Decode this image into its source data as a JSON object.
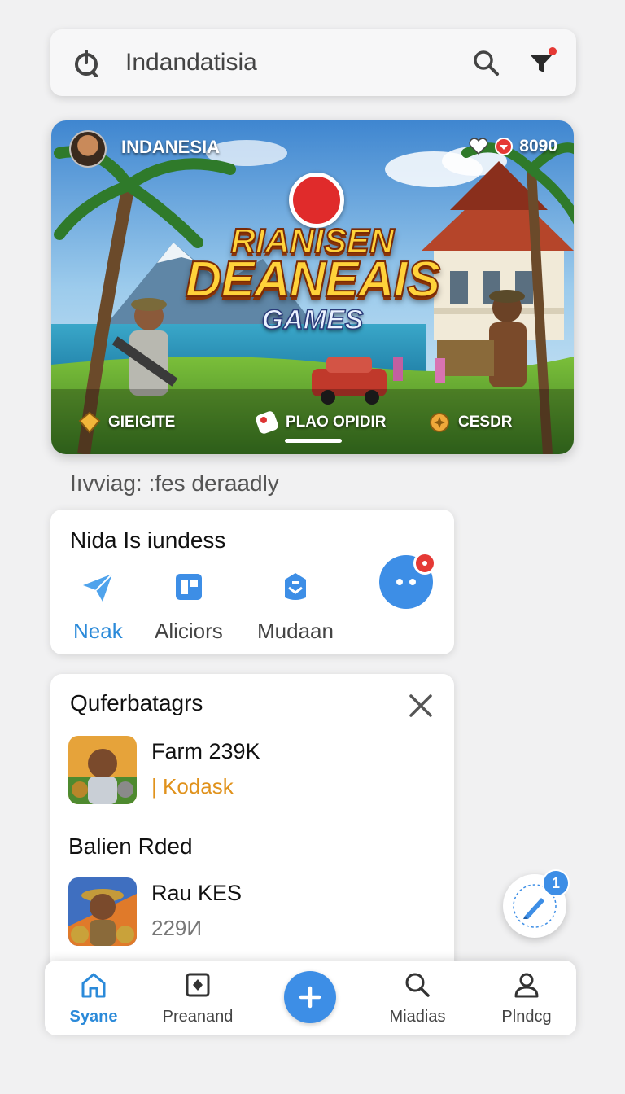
{
  "search": {
    "value": "Indandatisia"
  },
  "banner": {
    "country": "INDANESIA",
    "stats": "8090",
    "logo_line1": "RIANISEN",
    "logo_line2": "DEANEAIS",
    "logo_line3": "GAMES",
    "chips": [
      {
        "label": "GIEIGITE",
        "icon": "diamond-icon"
      },
      {
        "label": "PLAO OPIDIR",
        "icon": "tag-icon"
      },
      {
        "label": "CESDR",
        "icon": "coin-icon"
      }
    ]
  },
  "subtitle": "Iıvviag: :fes deraadly",
  "quick_actions": {
    "title": "Nida Is iundess",
    "items": [
      {
        "label": "Neak",
        "icon": "paper-plane-icon"
      },
      {
        "label": "Aliciors",
        "icon": "document-icon"
      },
      {
        "label": "Mudaan",
        "icon": "bag-icon"
      }
    ]
  },
  "recommendations": {
    "title": "Quferbatagrs",
    "games": [
      {
        "name": "Farm 239K",
        "meta": "| Kodask"
      }
    ],
    "section_title": "Balien Rded",
    "section_games": [
      {
        "name": "Rau KES",
        "meta": "229И"
      }
    ]
  },
  "compose_badge": "1",
  "bottom_nav": [
    {
      "label": "Syane",
      "icon": "home-icon"
    },
    {
      "label": "Preanand",
      "icon": "bookmark-icon"
    },
    {
      "label": "Miadias",
      "icon": "search-icon"
    },
    {
      "label": "Plndcg",
      "icon": "profile-icon"
    }
  ],
  "colors": {
    "accent": "#3d8ee6",
    "active_text": "#2b8ad9",
    "badge_red": "#e53935",
    "meta_orange": "#e0921c"
  }
}
